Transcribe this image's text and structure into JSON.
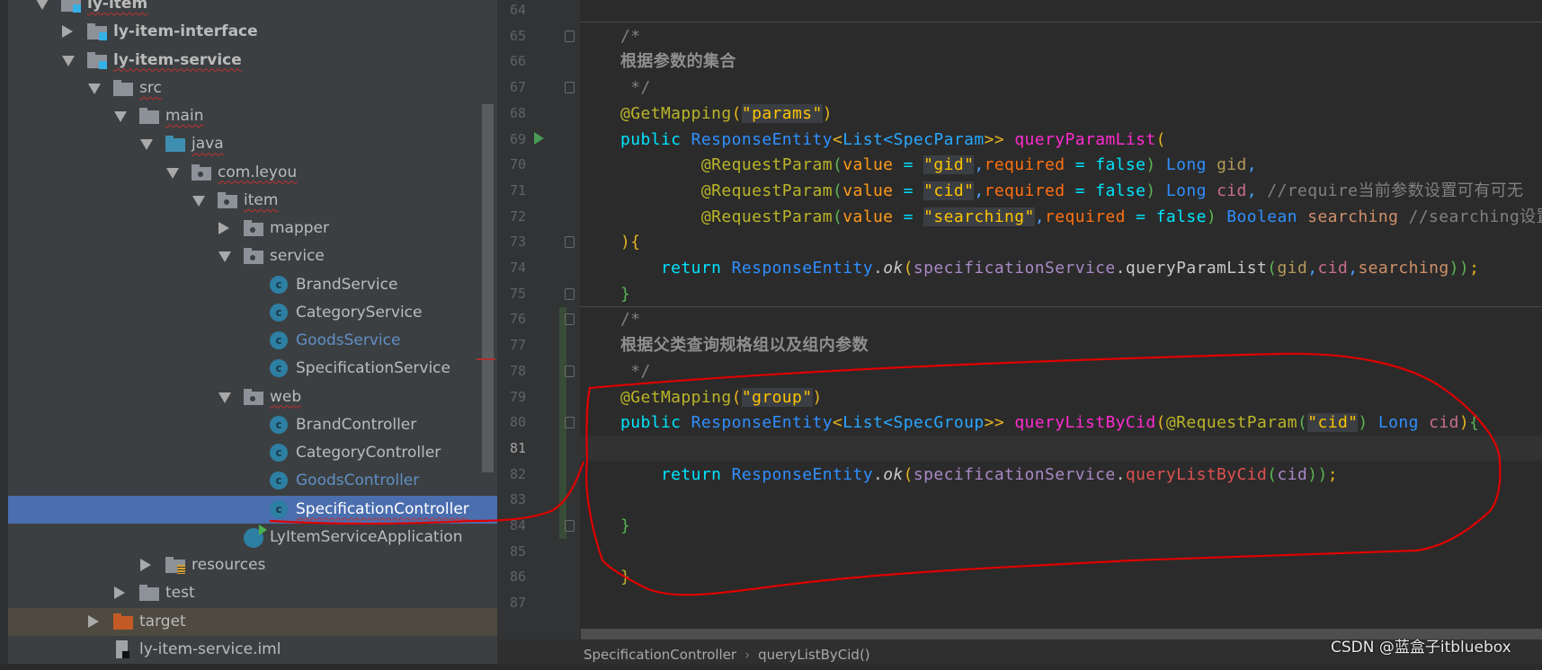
{
  "project_tree": [
    {
      "label": "ly-item",
      "depth": 0,
      "arrow": "open",
      "icon": "module-icon",
      "bold": true,
      "squiggle": true
    },
    {
      "label": "ly-item-interface",
      "depth": 1,
      "arrow": "closed",
      "icon": "module-icon",
      "bold": true
    },
    {
      "label": "ly-item-service",
      "depth": 1,
      "arrow": "open",
      "icon": "module-icon",
      "bold": true,
      "squiggle": true
    },
    {
      "label": "src",
      "depth": 2,
      "arrow": "open",
      "icon": "folder-icon",
      "squiggle": true
    },
    {
      "label": "main",
      "depth": 3,
      "arrow": "open",
      "icon": "folder-icon",
      "squiggle": true
    },
    {
      "label": "java",
      "depth": 4,
      "arrow": "open",
      "icon": "source-folder-icon",
      "squiggle": true
    },
    {
      "label": "com.leyou",
      "depth": 5,
      "arrow": "open",
      "icon": "package-icon",
      "squiggle": true
    },
    {
      "label": "item",
      "depth": 6,
      "arrow": "open",
      "icon": "package-icon",
      "squiggle": true
    },
    {
      "label": "mapper",
      "depth": 7,
      "arrow": "closed",
      "icon": "package-icon"
    },
    {
      "label": "service",
      "depth": 7,
      "arrow": "open",
      "icon": "package-icon"
    },
    {
      "label": "BrandService",
      "depth": 8,
      "icon": "class-icon"
    },
    {
      "label": "CategoryService",
      "depth": 8,
      "icon": "class-icon"
    },
    {
      "label": "GoodsService",
      "depth": 8,
      "icon": "class-icon",
      "modified": true
    },
    {
      "label": "SpecificationService",
      "depth": 8,
      "icon": "class-icon"
    },
    {
      "label": "web",
      "depth": 7,
      "arrow": "open",
      "icon": "package-icon",
      "squiggle": true
    },
    {
      "label": "BrandController",
      "depth": 8,
      "icon": "class-icon"
    },
    {
      "label": "CategoryController",
      "depth": 8,
      "icon": "class-icon"
    },
    {
      "label": "GoodsController",
      "depth": 8,
      "icon": "class-icon",
      "modified": true
    },
    {
      "label": "SpecificationController",
      "depth": 8,
      "icon": "class-icon",
      "selected": true,
      "squiggle": true
    },
    {
      "label": "LyItemServiceApplication",
      "depth": 7,
      "icon": "spring-boot-app-icon"
    },
    {
      "label": "resources",
      "depth": 4,
      "arrow": "closed",
      "icon": "resources-folder-icon"
    },
    {
      "label": "test",
      "depth": 3,
      "arrow": "closed",
      "icon": "folder-icon"
    },
    {
      "label": "target",
      "depth": 2,
      "arrow": "closed",
      "icon": "excluded-folder-icon",
      "excluded": true
    },
    {
      "label": "ly-item-service.iml",
      "depth": 2,
      "icon": "iml-file-icon"
    }
  ],
  "editor": {
    "lines": [
      {
        "n": "64",
        "tokens": []
      },
      {
        "n": "65",
        "tokens": [
          [
            "/*",
            "cm"
          ]
        ]
      },
      {
        "n": "66",
        "tokens": [
          [
            "根据参数的集合",
            "cmb"
          ]
        ]
      },
      {
        "n": "67",
        "tokens": [
          [
            " */",
            "cm"
          ]
        ]
      },
      {
        "n": "68",
        "tokens": [
          [
            "@GetMapping",
            "an"
          ],
          [
            "(",
            "p1"
          ],
          [
            "\"params\"",
            "st hl"
          ],
          [
            ")",
            "p1"
          ]
        ]
      },
      {
        "n": "69",
        "tokens": [
          [
            "public ",
            "kw"
          ],
          [
            "ResponseEntity",
            "ty"
          ],
          [
            "<",
            "p1"
          ],
          [
            "List",
            "ty2"
          ],
          [
            "<",
            "ty2"
          ],
          [
            "SpecParam",
            "ty2"
          ],
          [
            ">>",
            "p1"
          ],
          [
            " queryParamList",
            "fn"
          ],
          [
            "(",
            "p1"
          ]
        ]
      },
      {
        "n": "70",
        "tokens": [
          [
            "        @RequestParam",
            "an"
          ],
          [
            "(",
            "p2"
          ],
          [
            "value",
            "va"
          ],
          [
            " = ",
            "eq"
          ],
          [
            "\"gid\"",
            "st hl"
          ],
          [
            ",",
            "p3"
          ],
          [
            "required",
            "rq"
          ],
          [
            " = ",
            "eq"
          ],
          [
            "false",
            "kw"
          ],
          [
            ")",
            "p2"
          ],
          [
            " Long ",
            "ty"
          ],
          [
            "gid",
            "gid"
          ],
          [
            ",",
            "p3"
          ]
        ]
      },
      {
        "n": "71",
        "tokens": [
          [
            "        @RequestParam",
            "an"
          ],
          [
            "(",
            "p2"
          ],
          [
            "value",
            "va"
          ],
          [
            " = ",
            "eq"
          ],
          [
            "\"cid\"",
            "st hl"
          ],
          [
            ",",
            "p3"
          ],
          [
            "required",
            "rq"
          ],
          [
            " = ",
            "eq"
          ],
          [
            "false",
            "kw"
          ],
          [
            ")",
            "p2"
          ],
          [
            " Long ",
            "ty"
          ],
          [
            "cid",
            "cid"
          ],
          [
            ", ",
            "p3"
          ],
          [
            "//require当前参数设置可有可无",
            "cm"
          ]
        ]
      },
      {
        "n": "72",
        "tokens": [
          [
            "        @RequestParam",
            "an"
          ],
          [
            "(",
            "p2"
          ],
          [
            "value",
            "va"
          ],
          [
            " = ",
            "eq"
          ],
          [
            "\"searching\"",
            "st hl"
          ],
          [
            ",",
            "p3"
          ],
          [
            "required",
            "rq"
          ],
          [
            " = ",
            "eq"
          ],
          [
            "false",
            "kw"
          ],
          [
            ")",
            "p2"
          ],
          [
            " Boolean ",
            "ty"
          ],
          [
            "searching ",
            "sr"
          ],
          [
            "//searching设置",
            "cm"
          ]
        ]
      },
      {
        "n": "73",
        "tokens": [
          [
            "){",
            "p1"
          ]
        ]
      },
      {
        "n": "74",
        "tokens": [
          [
            "    return ",
            "kw"
          ],
          [
            "ResponseEntity",
            "ty"
          ],
          [
            ".",
            "pl"
          ],
          [
            "ok",
            "it"
          ],
          [
            "(",
            "p1"
          ],
          [
            "specificationService",
            "sv"
          ],
          [
            ".",
            "pl"
          ],
          [
            "queryParamList",
            "pl"
          ],
          [
            "(",
            "p2"
          ],
          [
            "gid",
            "gid"
          ],
          [
            ",",
            "p3"
          ],
          [
            "cid",
            "cid"
          ],
          [
            ",",
            "p3"
          ],
          [
            "searching",
            "sr"
          ],
          [
            "))",
            "p2"
          ],
          [
            ";",
            "p1"
          ]
        ]
      },
      {
        "n": "75",
        "tokens": [
          [
            "}",
            "p2"
          ]
        ]
      },
      {
        "n": "76",
        "tokens": [
          [
            "/*",
            "cm"
          ]
        ]
      },
      {
        "n": "77",
        "tokens": [
          [
            "根据父类查询规格组以及组内参数",
            "cmb"
          ]
        ]
      },
      {
        "n": "78",
        "tokens": [
          [
            " */",
            "cm"
          ]
        ]
      },
      {
        "n": "79",
        "tokens": [
          [
            "@GetMapping",
            "an"
          ],
          [
            "(",
            "p1"
          ],
          [
            "\"group\"",
            "st hl"
          ],
          [
            ")",
            "p1"
          ]
        ]
      },
      {
        "n": "80",
        "tokens": [
          [
            "public ",
            "kw"
          ],
          [
            "ResponseEntity",
            "ty"
          ],
          [
            "<",
            "p1"
          ],
          [
            "List",
            "ty2"
          ],
          [
            "<",
            "ty2"
          ],
          [
            "SpecGroup",
            "ty2"
          ],
          [
            ">>",
            "p1"
          ],
          [
            " queryListByCid",
            "fn"
          ],
          [
            "(",
            "p1"
          ],
          [
            "@RequestParam",
            "an"
          ],
          [
            "(",
            "p2"
          ],
          [
            "\"cid\"",
            "st hl"
          ],
          [
            ")",
            "p2"
          ],
          [
            " Long ",
            "ty"
          ],
          [
            "cid",
            "cid"
          ],
          [
            ")",
            "p1"
          ],
          [
            "{",
            "p2"
          ]
        ]
      },
      {
        "n": "81",
        "tokens": []
      },
      {
        "n": "82",
        "tokens": [
          [
            "    return ",
            "kw"
          ],
          [
            "ResponseEntity",
            "ty"
          ],
          [
            ".",
            "pl"
          ],
          [
            "ok",
            "it"
          ],
          [
            "(",
            "p1"
          ],
          [
            "specificationService",
            "sv"
          ],
          [
            ".",
            "pl"
          ],
          [
            "queryListByCid",
            "fn2"
          ],
          [
            "(",
            "p2"
          ],
          [
            "cid",
            "sv"
          ],
          [
            "))",
            "p2"
          ],
          [
            ";",
            "p1"
          ]
        ]
      },
      {
        "n": "83",
        "tokens": []
      },
      {
        "n": "84",
        "tokens": [
          [
            "}",
            "p2"
          ]
        ]
      },
      {
        "n": "85",
        "tokens": []
      },
      {
        "n": "86",
        "tokens": [
          [
            "}",
            "an"
          ]
        ]
      },
      {
        "n": "87",
        "tokens": []
      }
    ],
    "current_line": "81"
  },
  "breadcrumb": {
    "items": [
      "SpecificationController",
      "queryListByCid()"
    ],
    "separator": "›"
  },
  "watermark": "CSDN @蓝盒子itbluebox",
  "colors": {
    "selection": "#4b6eaf",
    "editor_bg": "#2b2b2b",
    "panel_bg": "#3c3f41",
    "annotation_ink": "#e00000"
  }
}
